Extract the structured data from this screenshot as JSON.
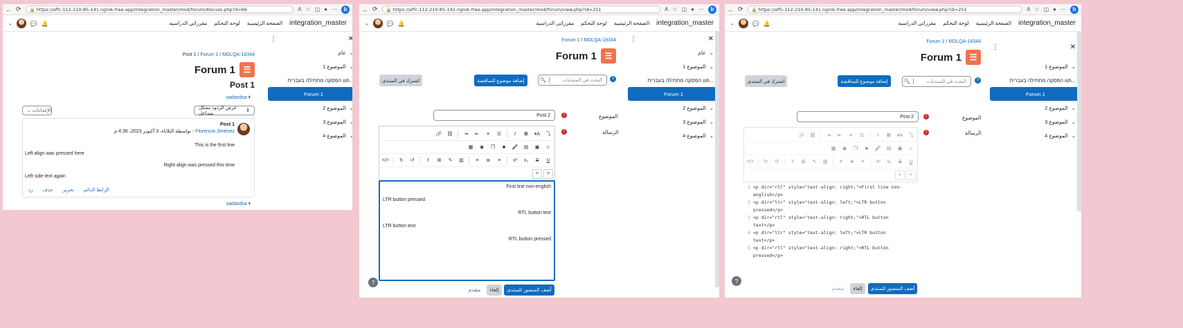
{
  "win1": {
    "url": "https://affc-112-210-85-141.ngrok-free.app/integration_master/mod/forum/discuss.php?d=66",
    "brand": "integration_master",
    "nav": [
      "الصفحة الرئيسية",
      "لوحة التحكم",
      "مقرراتي الدراسية"
    ],
    "drawer": {
      "general": "عام",
      "topic1": "الموضوع 1",
      "hebrew": "הפסקה מתחילה בעברית ish...",
      "forum": "Forum 1",
      "topic2": "الموضوع 2",
      "topic3": "الموضوع 3",
      "topic4": "الموضوع 4"
    },
    "crumb": {
      "a": "Post 1",
      "b": "Forum 1",
      "c": "MDLQA-18344"
    },
    "title": "Forum 1",
    "post_heading": "Post 1",
    "sadasdsa": "sadasdsa",
    "display_mode": "عرض الردود بشكل متداخل",
    "settings": "الإعدادات",
    "post": {
      "subject": "Post 1",
      "byline": "بواسطة الثلاثاء، 3 أكتوبر 2023، 4:36 م -",
      "author": "Florencia Jiménez",
      "lines": [
        "This is the first line",
        "Left align was pressed here",
        "Right align was pressed this time",
        "Left side text again"
      ],
      "actions": {
        "permalink": "الرابط الدائم",
        "edit": "تحرير",
        "delete": "حذف",
        "reply": "رد"
      }
    },
    "sadasdsa2": "sadasdsa"
  },
  "win2": {
    "url": "https://affc-112-210-85-141.ngrok-free.app/integration_master/mod/forum/view.php?id=251",
    "brand": "integration_master",
    "nav": [
      "الصفحة الرئيسية",
      "لوحة التحكم",
      "مقرراتي الدراسية"
    ],
    "drawer": {
      "general": "عام",
      "topic1": "الموضوع 1",
      "hebrew": "הפסקה מתחילה בעברית ish...",
      "forum": "Forum 1",
      "topic2": "الموضوع 2",
      "topic3": "الموضوع 3",
      "topic4": "الموضوع 4"
    },
    "crumb": {
      "b": "Forum 1",
      "c": "MDLQA-18344"
    },
    "title": "Forum 1",
    "search_placeholder": "البحث في المنتديات",
    "add_topic": "إضافة موضوع للمناقشة",
    "subscribe": "اشترك في المنتدى",
    "subject_label": "الموضوع",
    "subject_value": "Post 2",
    "message_label": "الرسالة",
    "editor_lines": [
      "First line non-english",
      "LTR button pressed",
      "RTL button text",
      "LTR button text",
      "RTL button pressed"
    ],
    "post_btn": "أضف المنشور للمنتدى",
    "cancel": "إلغاء",
    "advanced": "متقدم"
  },
  "win3": {
    "url": "https://affc-112-210-85-141.ngrok-free.app/integration_master/mod/forum/view.php?id=251",
    "brand": "integration_master",
    "nav": [
      "الصفحة الرئيسية",
      "لوحة التحكم",
      "مقرراتي الدراسية"
    ],
    "drawer": {
      "topic1": "الموضوع 1",
      "hebrew": "הפסקה מתחילה בעברית ish...",
      "forum": "Forum 1",
      "topic2": "الموضوع 2",
      "topic3": "الموضوع 3",
      "topic4": "الموضوع 4"
    },
    "crumb": {
      "b": "Forum 1",
      "c": "MDLQA-18344"
    },
    "title": "Forum 1",
    "search_placeholder": "البحث في المنتديات",
    "add_topic": "إضافة موضوع للمناقشة",
    "subscribe": "اشترك في المنتدى",
    "subject_label": "الموضوع",
    "subject_value": "Post 2",
    "message_label": "الرسالة",
    "code_lines": [
      {
        "n": "1",
        "t": "<p dir=\"rtl\" style=\"text-align: right;\">First line non-"
      },
      {
        "n": "",
        "t": "english</p>"
      },
      {
        "n": "2",
        "t": "<p dir=\"ltr\" style=\"text-align: left;\">LTR button"
      },
      {
        "n": "",
        "t": "pressed</p>"
      },
      {
        "n": "3",
        "t": "<p dir=\"rtl\" style=\"text-align: right;\">RTL button"
      },
      {
        "n": "",
        "t": "text</p>"
      },
      {
        "n": "4",
        "t": "<p dir=\"ltr\" style=\"text-align: left;\">LTR button"
      },
      {
        "n": "",
        "t": "text</p>"
      },
      {
        "n": "5",
        "t": "<p dir=\"rtl\" style=\"text-align: right;\">RTL button"
      },
      {
        "n": "",
        "t": "pressed</p>"
      }
    ],
    "post_btn": "أضف المنشور للمنتدى",
    "cancel": "إلغاء",
    "advanced": "متقدم"
  }
}
